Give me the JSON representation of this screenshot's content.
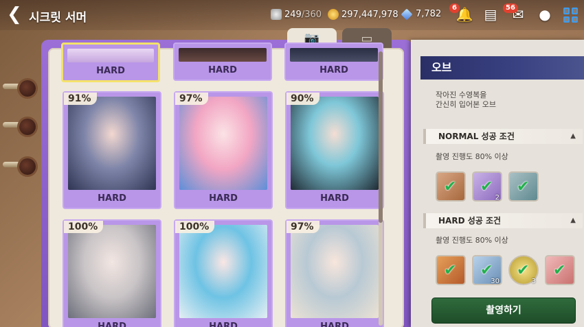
{
  "header": {
    "title": "시크릿 서머",
    "stamina_current": "249",
    "stamina_max": "/360",
    "gold": "297,447,978",
    "gems": "7,782",
    "notifications_badge": "6",
    "mail_badge": "56"
  },
  "tabs": {
    "camera_icon": "📷",
    "album_icon": "▭"
  },
  "cards": [
    {
      "percent": "",
      "level": "HARD",
      "selected": true
    },
    {
      "percent": "",
      "level": "HARD"
    },
    {
      "percent": "",
      "level": "HARD"
    },
    {
      "percent": "91%",
      "level": "HARD"
    },
    {
      "percent": "97%",
      "level": "HARD"
    },
    {
      "percent": "90%",
      "level": "HARD"
    },
    {
      "percent": "100%",
      "level": "HARD"
    },
    {
      "percent": "100%",
      "level": "HARD"
    },
    {
      "percent": "97%",
      "level": "HARD"
    }
  ],
  "panel": {
    "character_name": "오브",
    "description_line1": "작아진 수영복을",
    "description_line2": "간신히 입어본 오브",
    "normal": {
      "heading": "NORMAL 성공 조건",
      "condition": "촬영 진행도 80% 이상",
      "rewards": [
        {
          "icon": "bag-icon",
          "count": ""
        },
        {
          "icon": "flower-icon",
          "count": "2"
        },
        {
          "icon": "crystal-icon",
          "count": ""
        }
      ]
    },
    "hard": {
      "heading": "HARD 성공 조건",
      "condition": "촬영 진행도 80% 이상",
      "rewards": [
        {
          "icon": "crystal-orange-icon",
          "count": ""
        },
        {
          "icon": "crystal-blue-icon",
          "count": "30"
        },
        {
          "icon": "coin-icon",
          "count": "3"
        },
        {
          "icon": "gift-box-icon",
          "count": ""
        }
      ]
    },
    "shoot_button": "촬영하기"
  },
  "colors": {
    "accent_purple": "#9b6fd6",
    "panel_title_navy": "#2a2f66",
    "button_green": "#2f6b3c",
    "check_green": "#22b14c"
  }
}
